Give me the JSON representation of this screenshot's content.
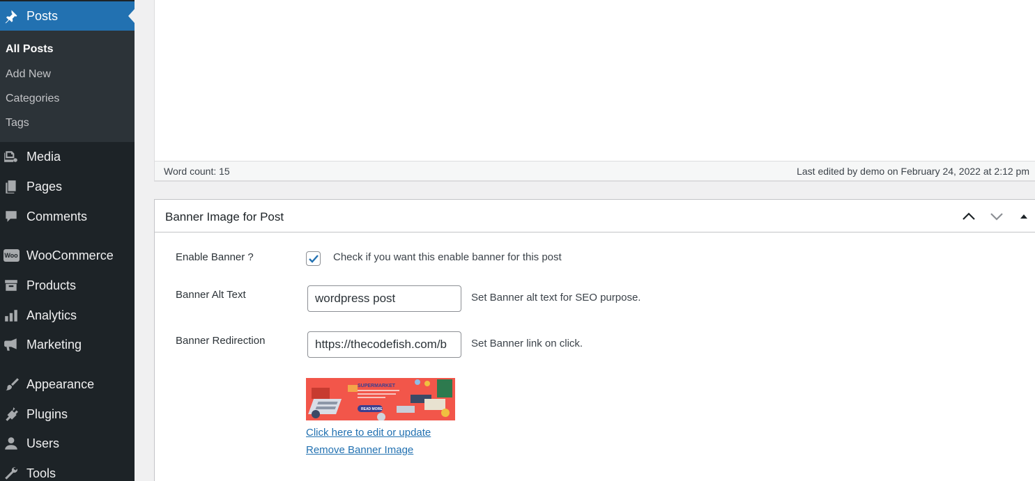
{
  "sidebar": {
    "posts_label": "Posts",
    "submenu": [
      "All Posts",
      "Add New",
      "Categories",
      "Tags"
    ],
    "items": [
      "Media",
      "Pages",
      "Comments",
      "WooCommerce",
      "Products",
      "Analytics",
      "Marketing",
      "Appearance",
      "Plugins",
      "Users",
      "Tools"
    ],
    "woo_badge": "Woo"
  },
  "editor": {
    "word_count": "Word count: 15",
    "last_edited": "Last edited by demo on February 24, 2022 at 2:12 pm"
  },
  "metabox": {
    "title": "Banner Image for Post",
    "enable_label": "Enable Banner ?",
    "enable_checked": true,
    "enable_desc": "Check if you want this enable banner for this post",
    "alt_label": "Banner Alt Text",
    "alt_value": "wordpress post",
    "alt_desc": "Set Banner alt text for SEO purpose.",
    "redirect_label": "Banner Redirection",
    "redirect_value": "https://thecodefish.com/b",
    "redirect_desc": "Set Banner link on click.",
    "edit_link": "Click here to edit or update",
    "remove_link": "Remove Banner Image",
    "banner": {
      "heading": "SUPERMARKET",
      "button": "READ MORE"
    }
  },
  "colors": {
    "sidebar_bg": "#1d2327",
    "submenu_bg": "#2c3338",
    "accent": "#2271b1",
    "banner_bg": "#f2564a"
  }
}
